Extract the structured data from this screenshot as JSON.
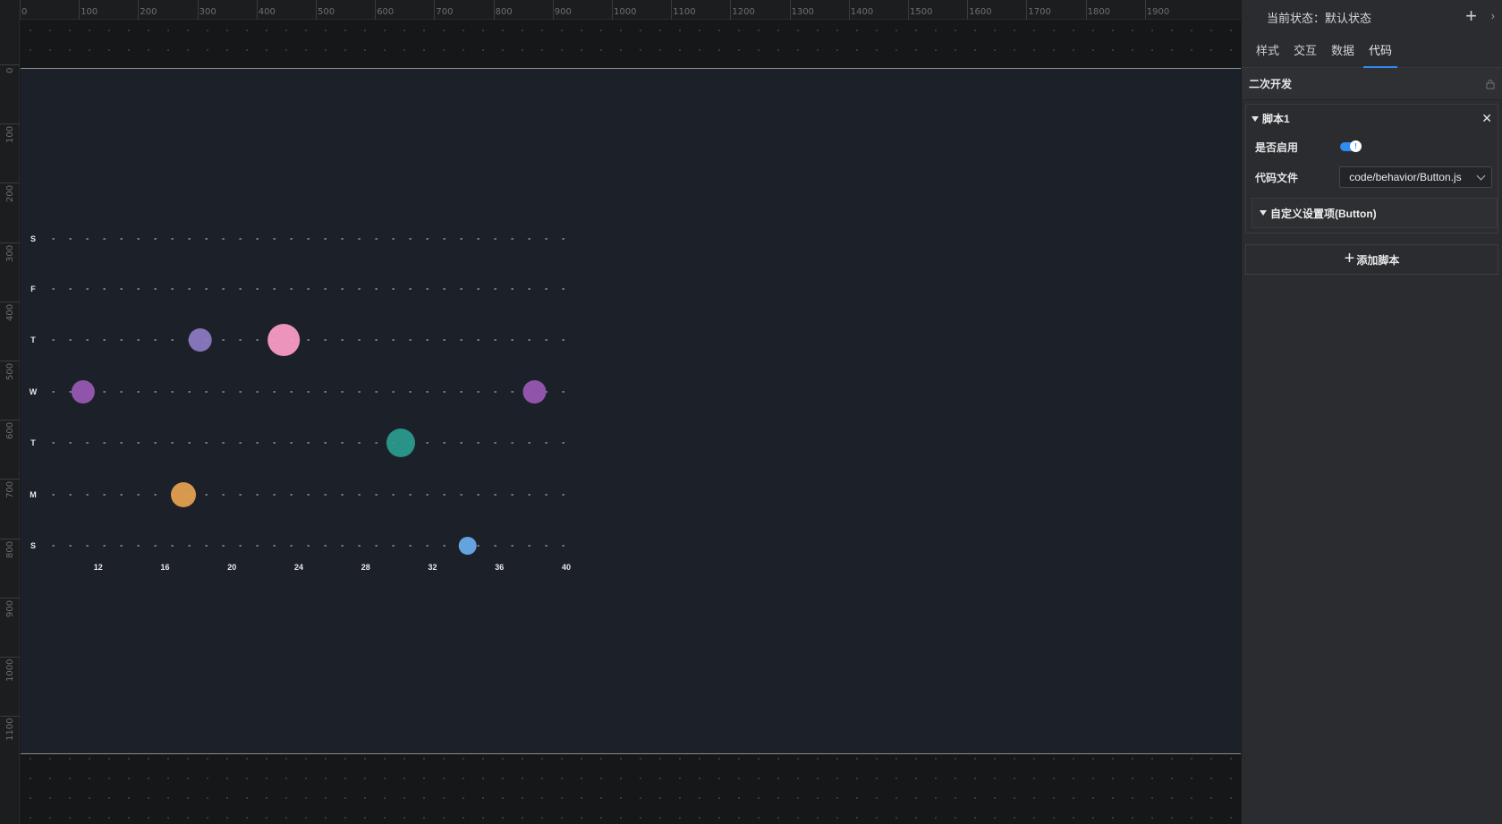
{
  "ruler": {
    "top_labels": [
      "0",
      "100",
      "200",
      "300",
      "400",
      "500",
      "600",
      "700",
      "800",
      "900",
      "1000",
      "1100",
      "1200",
      "1300",
      "1400",
      "1500",
      "1600",
      "1700",
      "1800",
      "1900"
    ],
    "left_labels": [
      "0",
      "100",
      "200",
      "300",
      "400",
      "500",
      "600",
      "700",
      "800",
      "900",
      "1000",
      "1100"
    ]
  },
  "chart_data": {
    "type": "scatter",
    "title": "",
    "xlabel": "",
    "ylabel": "",
    "y_categories": [
      "S",
      "M",
      "T",
      "W",
      "T",
      "F",
      "S"
    ],
    "x_ticks": [
      12,
      16,
      20,
      24,
      28,
      32,
      36,
      40
    ],
    "xlim": [
      9.5,
      40
    ],
    "grid": "dotted horizontal",
    "points": [
      {
        "x": 11.1,
        "y": "W",
        "size": 13,
        "color": "#9b59b6"
      },
      {
        "x": 38.1,
        "y": "W",
        "size": 13,
        "color": "#9b59b6"
      },
      {
        "x": 18.1,
        "y": "T",
        "size": 13,
        "color": "#8e7cc3"
      },
      {
        "x": 23.1,
        "y": "T",
        "size": 18,
        "color": "#ff9ec8"
      },
      {
        "x": 30.1,
        "y": "T2",
        "size": 16,
        "color": "#2a9d8f"
      },
      {
        "x": 17.1,
        "y": "M",
        "size": 14,
        "color": "#e8a350"
      },
      {
        "x": 34.1,
        "y": "S_bottom",
        "size": 10,
        "color": "#6aaef0"
      }
    ]
  },
  "panel": {
    "state_label": "当前状态：默认状态",
    "tabs": [
      "样式",
      "交互",
      "数据",
      "代码"
    ],
    "active_tab": "代码",
    "section_title": "二次开发",
    "script": {
      "title": "脚本1",
      "enable_label": "是否启用",
      "enabled": true,
      "code_file_label": "代码文件",
      "code_file_value": "code/behavior/Button.js",
      "custom_settings_label": "自定义设置项(Button)"
    },
    "add_script_label": "添加脚本"
  },
  "colors": {
    "accent": "#2f8cf0",
    "screen_bg": "#1c2129"
  }
}
